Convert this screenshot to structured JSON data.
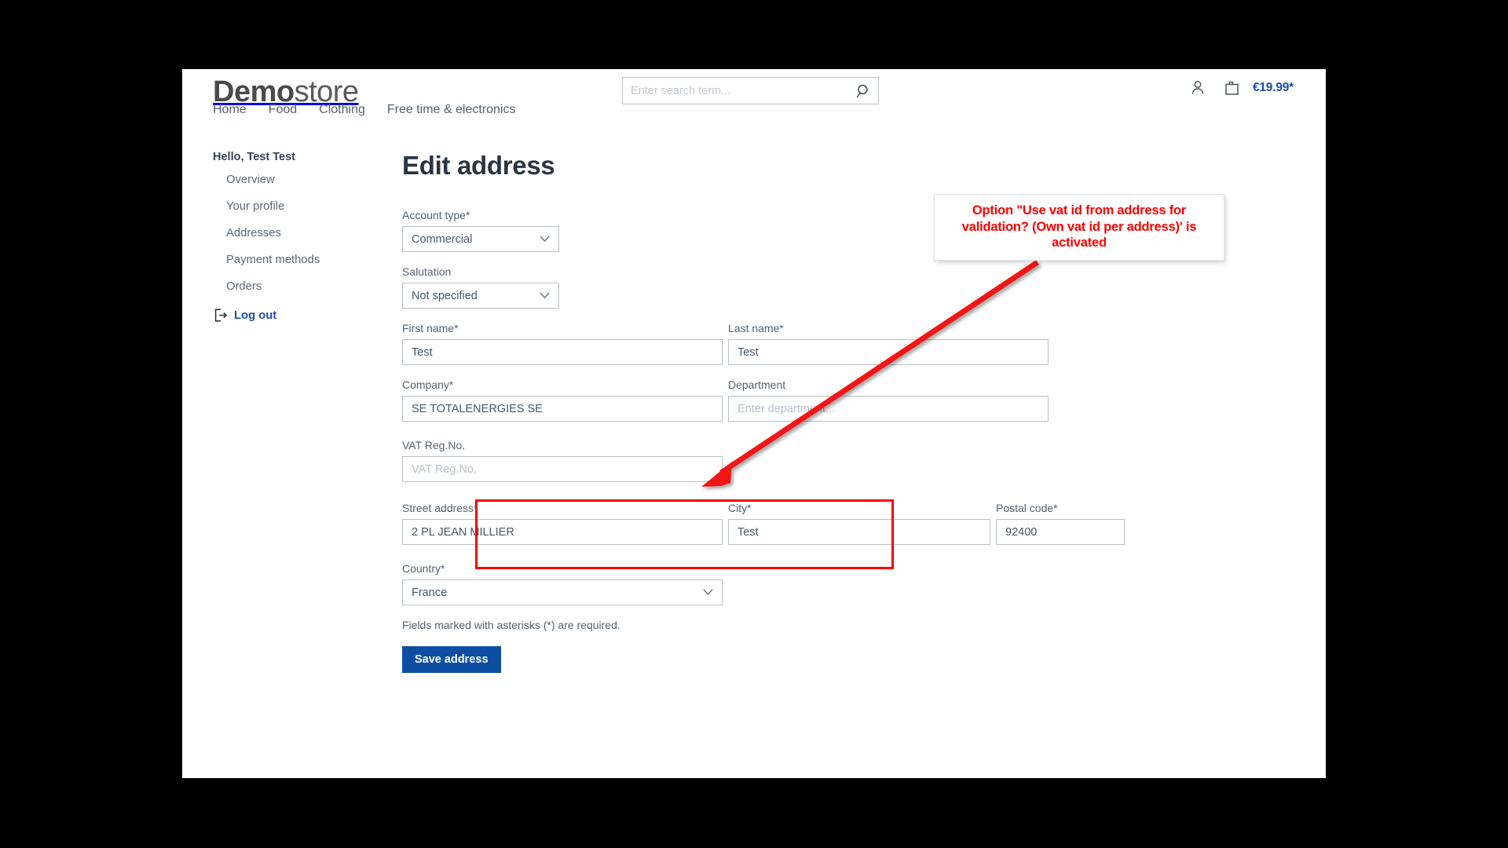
{
  "header": {
    "logo_bold": "Demo",
    "logo_light": "store",
    "search_placeholder": "Enter search term...",
    "search_value": "",
    "cart_total": "€19.99*",
    "account_icon": "user-icon",
    "cart_icon": "shopping-bag-icon",
    "search_icon": "search-icon"
  },
  "nav": {
    "items": [
      {
        "label": "Home"
      },
      {
        "label": "Food"
      },
      {
        "label": "Clothing"
      },
      {
        "label": "Free time & electronics"
      }
    ]
  },
  "sidebar": {
    "greeting": "Hello, Test Test",
    "items": [
      {
        "label": "Overview"
      },
      {
        "label": "Your profile"
      },
      {
        "label": "Addresses"
      },
      {
        "label": "Payment methods"
      },
      {
        "label": "Orders"
      }
    ],
    "logout_label": "Log out",
    "logout_icon": "logout-icon"
  },
  "main": {
    "title": "Edit address",
    "account_type": {
      "label": "Account type*",
      "value": "Commercial"
    },
    "salutation": {
      "label": "Salutation",
      "value": "Not specified"
    },
    "first_name": {
      "label": "First name*",
      "value": "Test"
    },
    "last_name": {
      "label": "Last name*",
      "value": "Test"
    },
    "company": {
      "label": "Company*",
      "value": "SE TOTALENERGIES SE"
    },
    "department": {
      "label": "Department",
      "value": "",
      "placeholder": "Enter department..."
    },
    "vat": {
      "label": "VAT Reg.No.",
      "value": "",
      "placeholder": "VAT Reg.No."
    },
    "street": {
      "label": "Street address*",
      "value": "2 PL JEAN MILLIER"
    },
    "city": {
      "label": "City*",
      "value": "Test"
    },
    "postal_code": {
      "label": "Postal code*",
      "value": "92400"
    },
    "country": {
      "label": "Country*",
      "value": "France"
    },
    "required_hint": "Fields marked with asterisks (*) are required.",
    "save_label": "Save address"
  },
  "annotation": {
    "text": "Option \"Use vat id from address for validation? (Own vat id per address)' is activated",
    "color": "#ff0000",
    "arrow": "red-arrow",
    "highlight_target": "vat-field"
  }
}
